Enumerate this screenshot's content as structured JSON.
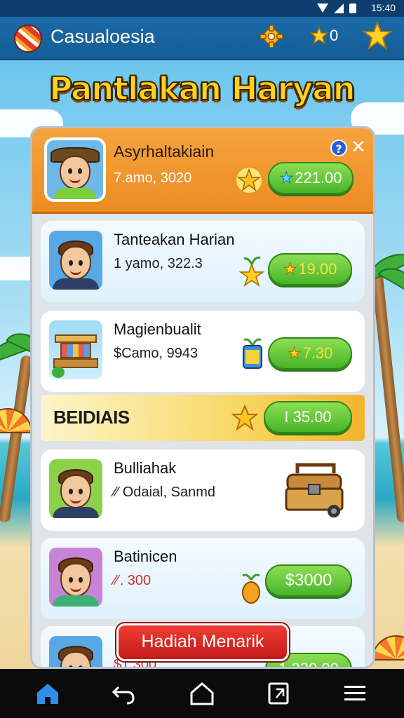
{
  "status_bar": {
    "time": "15:40"
  },
  "app_bar": {
    "title": "Casualoesia",
    "coins": "0"
  },
  "page_title": "Pantlakan Haryan",
  "header_card": {
    "name": "Asyrhaltakiain",
    "subtitle": "7.amo, 3020",
    "reward": "221.00"
  },
  "items": [
    {
      "name": "Tanteakan Harian",
      "subtitle": "1 yamo, 322.3",
      "reward": "19.00"
    },
    {
      "name": "Magienbualit",
      "subtitle": "$Camo, 9943",
      "reward": "7.30"
    }
  ],
  "section": {
    "title": "BEIDIAIS",
    "reward": "I 35.00"
  },
  "section_items": [
    {
      "name": "Bulliahak",
      "subtitle": "Odaial, Sanmd"
    },
    {
      "name": "Batinicen",
      "subtitle": ". 300",
      "reward": "$3000"
    },
    {
      "subtitle": "$1,300",
      "reward": "1,330.00"
    }
  ],
  "cta": {
    "label": "Hadiah Menarik"
  },
  "colors": {
    "appbar": "#155d96",
    "header": "#ec8c22",
    "button_green": "#48b52a",
    "cta_red": "#c21a1a",
    "title_gold": "#ffd21f"
  },
  "icons": [
    "gear-icon",
    "coin-star-icon",
    "star-icon",
    "help-icon",
    "close-icon",
    "home-icon",
    "back-icon",
    "house-icon",
    "recents-icon",
    "menu-icon"
  ]
}
